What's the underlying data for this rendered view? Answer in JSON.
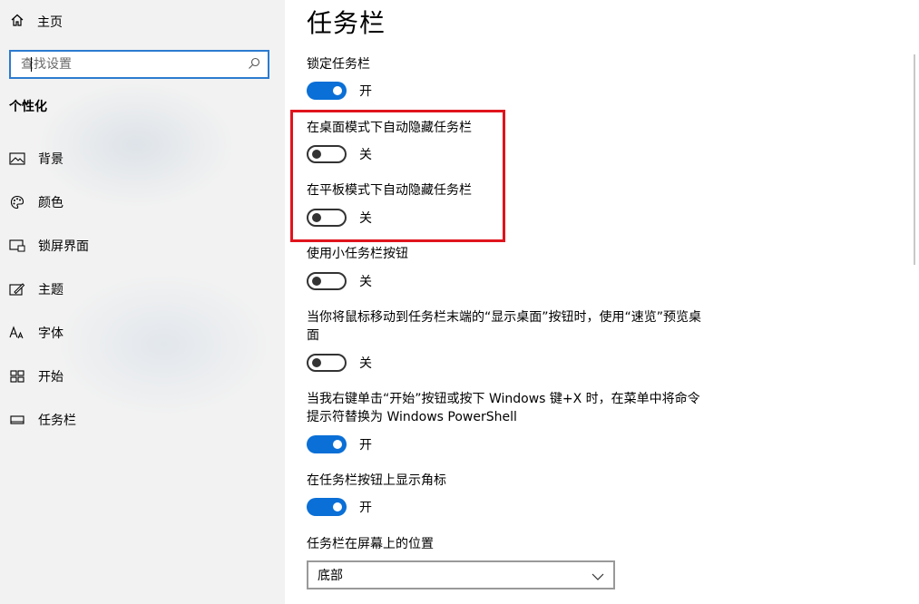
{
  "sidebar": {
    "home_label": "主页",
    "search_placeholder": "查找设置",
    "section_title": "个性化",
    "items": [
      {
        "label": "背景",
        "icon": "picture-icon"
      },
      {
        "label": "颜色",
        "icon": "palette-icon"
      },
      {
        "label": "锁屏界面",
        "icon": "lock-screen-icon"
      },
      {
        "label": "主题",
        "icon": "theme-brush-icon"
      },
      {
        "label": "字体",
        "icon": "font-icon"
      },
      {
        "label": "开始",
        "icon": "start-grid-icon"
      },
      {
        "label": "任务栏",
        "icon": "taskbar-icon"
      }
    ]
  },
  "main": {
    "title": "任务栏",
    "settings": [
      {
        "label": "锁定任务栏",
        "state": "开",
        "on": true
      },
      {
        "label": "在桌面模式下自动隐藏任务栏",
        "state": "关",
        "on": false
      },
      {
        "label": "在平板模式下自动隐藏任务栏",
        "state": "关",
        "on": false
      },
      {
        "label": "使用小任务栏按钮",
        "state": "关",
        "on": false
      },
      {
        "label": "当你将鼠标移动到任务栏末端的“显示桌面”按钮时，使用“速览”预览桌面",
        "state": "关",
        "on": false
      },
      {
        "label": "当我右键单击“开始”按钮或按下 Windows 键+X 时，在菜单中将命令提示符替换为 Windows PowerShell",
        "state": "开",
        "on": true
      },
      {
        "label": "在任务栏按钮上显示角标",
        "state": "开",
        "on": true
      }
    ],
    "position_label": "任务栏在屏幕上的位置",
    "position_value": "底部"
  },
  "colors": {
    "accent": "#0a6fd6",
    "highlight": "#e0141d"
  }
}
